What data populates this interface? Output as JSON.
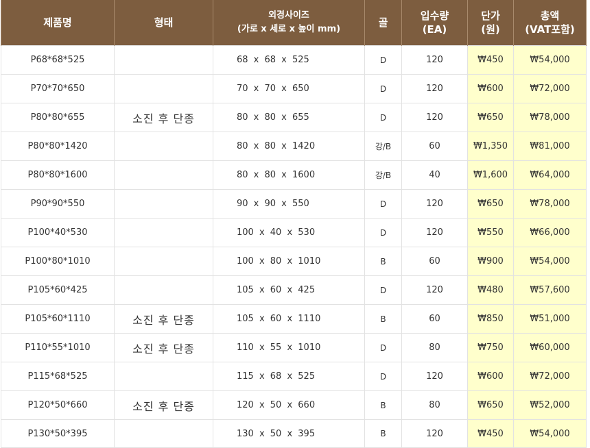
{
  "headers": {
    "product": "제품명",
    "form": "형태",
    "size_line1": "외경사이즈",
    "size_line2": "(가로 x 세로 x 높이 mm)",
    "flute": "골",
    "qty_line1": "입수량",
    "qty_line2": "(EA)",
    "price_line1": "단가",
    "price_line2": "(원)",
    "total_line1": "총액",
    "total_line2": "(VAT포함)"
  },
  "rows": [
    {
      "product": "P68*68*525",
      "form": "",
      "size": "68 x 68 x 525",
      "flute": "D",
      "qty": "120",
      "price": "₩450",
      "total": "₩54,000"
    },
    {
      "product": "P70*70*650",
      "form": "",
      "size": "70 x 70 x 650",
      "flute": "D",
      "qty": "120",
      "price": "₩600",
      "total": "₩72,000"
    },
    {
      "product": "P80*80*655",
      "form": "소진 후 단종",
      "size": "80 x 80 x 655",
      "flute": "D",
      "qty": "120",
      "price": "₩650",
      "total": "₩78,000"
    },
    {
      "product": "P80*80*1420",
      "form": "",
      "size": "80 x 80 x 1420",
      "flute": "강/B",
      "qty": "60",
      "price": "₩1,350",
      "total": "₩81,000"
    },
    {
      "product": "P80*80*1600",
      "form": "",
      "size": "80 x 80 x 1600",
      "flute": "강/B",
      "qty": "40",
      "price": "₩1,600",
      "total": "₩64,000"
    },
    {
      "product": "P90*90*550",
      "form": "",
      "size": "90 x 90 x 550",
      "flute": "D",
      "qty": "120",
      "price": "₩650",
      "total": "₩78,000"
    },
    {
      "product": "P100*40*530",
      "form": "",
      "size": "100 x 40 x 530",
      "flute": "D",
      "qty": "120",
      "price": "₩550",
      "total": "₩66,000"
    },
    {
      "product": "P100*80*1010",
      "form": "",
      "size": "100 x 80 x 1010",
      "flute": "B",
      "qty": "60",
      "price": "₩900",
      "total": "₩54,000"
    },
    {
      "product": "P105*60*425",
      "form": "",
      "size": "105 x 60 x 425",
      "flute": "D",
      "qty": "120",
      "price": "₩480",
      "total": "₩57,600"
    },
    {
      "product": "P105*60*1110",
      "form": "소진 후 단종",
      "size": "105 x 60 x 1110",
      "flute": "B",
      "qty": "60",
      "price": "₩850",
      "total": "₩51,000"
    },
    {
      "product": "P110*55*1010",
      "form": "소진 후 단종",
      "size": "110 x 55 x 1010",
      "flute": "D",
      "qty": "80",
      "price": "₩750",
      "total": "₩60,000"
    },
    {
      "product": "P115*68*525",
      "form": "",
      "size": "115 x 68 x 525",
      "flute": "D",
      "qty": "120",
      "price": "₩600",
      "total": "₩72,000"
    },
    {
      "product": "P120*50*660",
      "form": "소진 후 단종",
      "size": "120 x 50 x 660",
      "flute": "B",
      "qty": "80",
      "price": "₩650",
      "total": "₩52,000"
    },
    {
      "product": "P130*50*395",
      "form": "",
      "size": "130 x 50 x 395",
      "flute": "B",
      "qty": "120",
      "price": "₩450",
      "total": "₩54,000"
    }
  ],
  "colors": {
    "header_bg": "#7d5d3f",
    "header_text": "#ffffff",
    "highlight_bg": "#ffffcc",
    "border": "#e2e2e2"
  }
}
